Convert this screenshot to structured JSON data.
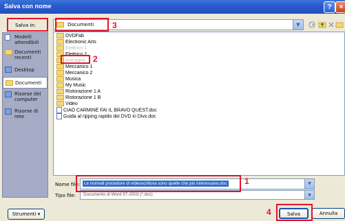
{
  "window": {
    "title": "Salva con nome"
  },
  "location": {
    "label": "Salva in:",
    "value": "Documenti"
  },
  "places": [
    {
      "label": "Modelli attendibili",
      "icon": "templates-icon"
    },
    {
      "label": "Documenti recenti",
      "icon": "recent-documents-icon"
    },
    {
      "label": "Desktop",
      "icon": "desktop-icon"
    },
    {
      "label": "Documenti",
      "icon": "documents-icon"
    },
    {
      "label": "Risorse del computer",
      "icon": "computer-icon"
    },
    {
      "label": "Risorse di rete",
      "icon": "network-icon"
    }
  ],
  "files": [
    {
      "name": "DVDFab",
      "type": "folder"
    },
    {
      "name": "Electronic Arts",
      "type": "folder"
    },
    {
      "name": "Elettrico 1",
      "type": "folder"
    },
    {
      "name": "Elettrico 2",
      "type": "folder"
    },
    {
      "name": "Immagini",
      "type": "folder"
    },
    {
      "name": "Meccanico 1",
      "type": "folder"
    },
    {
      "name": "Meccanico 2",
      "type": "folder"
    },
    {
      "name": "Musica",
      "type": "folder"
    },
    {
      "name": "My Music",
      "type": "folder"
    },
    {
      "name": "Ristorazione 1 A",
      "type": "folder"
    },
    {
      "name": "Ristorazione 1 B",
      "type": "folder"
    },
    {
      "name": "Video",
      "type": "folder"
    },
    {
      "name": "CIAO CARMINE FAI IL BRAVO QUEST.doc",
      "type": "doc"
    },
    {
      "name": "Guida al ripping rapido dei DVD in Divx.doc",
      "type": "doc"
    }
  ],
  "filename": {
    "label": "Nome file:",
    "value": "Le normali procedure di videoscrittura sono quelle che più interessano.doc"
  },
  "filetype": {
    "label": "Tipo file:",
    "value": "Documento di Word 97-2003 (*.doc)"
  },
  "buttons": {
    "tools": "Strumenti",
    "save": "Salva",
    "cancel": "Annulla"
  },
  "annotations": [
    "1",
    "2",
    "3",
    "4"
  ],
  "colors": {
    "annotation": "#e8102a",
    "titlebar": "#2a5bcf",
    "selection": "#316ac5"
  }
}
